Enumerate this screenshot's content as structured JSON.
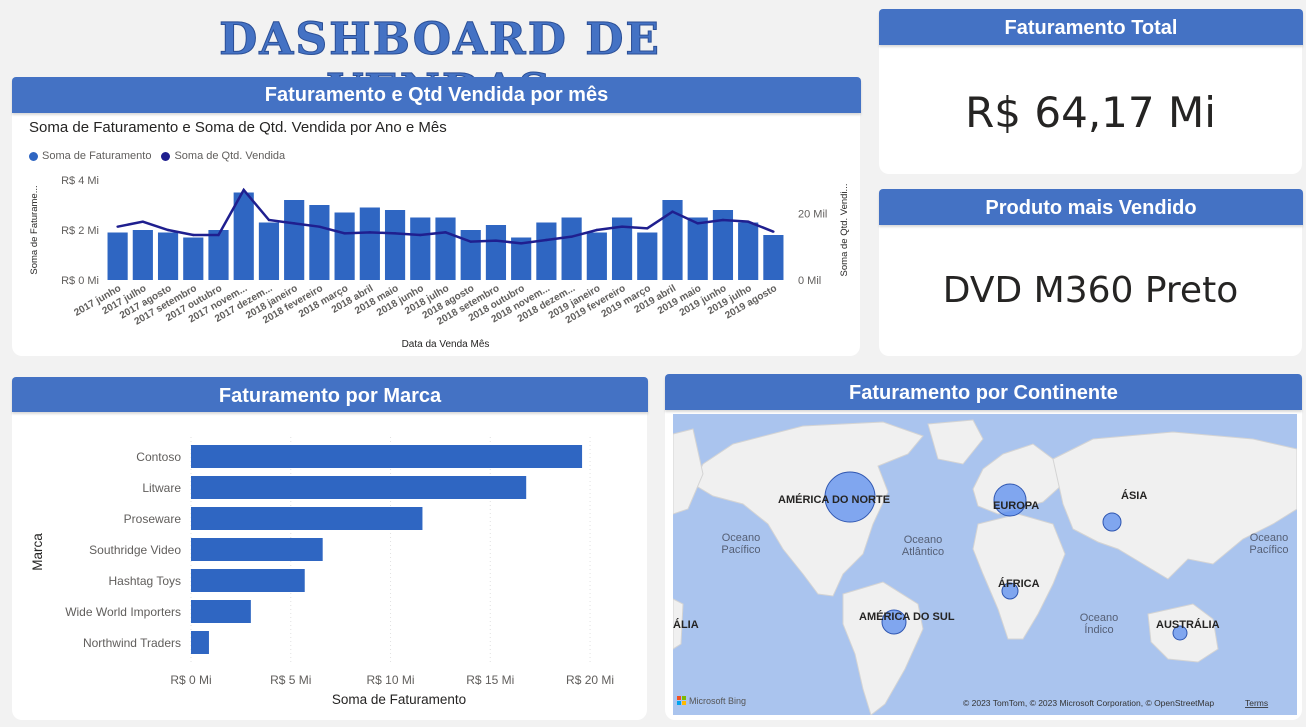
{
  "dashboard_title": "DASHBOARD DE VENDAS",
  "colors": {
    "accent": "#4472c4",
    "bar": "#2f66c2",
    "line": "#1f1f8f",
    "map_bubble": "#5b8def"
  },
  "kpi_total": {
    "header": "Faturamento Total",
    "value": "R$ 64,17 Mi"
  },
  "kpi_product": {
    "header": "Produto mais Vendido",
    "value": "DVD M360 Preto"
  },
  "combo": {
    "header": "Faturamento e Qtd Vendida por mês",
    "subtitle": "Soma de Faturamento e Soma de Qtd. Vendida por Ano e Mês",
    "legend": [
      "Soma de Faturamento",
      "Soma de Qtd. Vendida"
    ],
    "y_left_label": "Soma de Faturame...",
    "y_right_label": "Soma de Qtd. Vendi...",
    "x_label": "Data da Venda Mês",
    "y_left_ticks": [
      "R$ 0 Mi",
      "R$ 2 Mi",
      "R$ 4 Mi"
    ],
    "y_right_ticks": [
      "0 Mil",
      "20 Mil"
    ]
  },
  "brand": {
    "header": "Faturamento por Marca",
    "y_label": "Marca",
    "x_label": "Soma de Faturamento",
    "x_ticks": [
      "R$ 0 Mi",
      "R$ 5 Mi",
      "R$ 10 Mi",
      "R$ 15 Mi",
      "R$ 20 Mi"
    ]
  },
  "map": {
    "header": "Faturamento por Continente",
    "labels": [
      "AMÉRICA DO NORTE",
      "EUROPA",
      "ÁSIA",
      "ÁFRICA",
      "AMÉRICA DO SUL",
      "AUSTRÁLIA",
      "ÁLIA"
    ],
    "oceans": [
      "Oceano Pacífico",
      "Oceano Atlântico",
      "Oceano Índico",
      "Oceano Pacífico"
    ],
    "bing": "Microsoft Bing",
    "copyright": "© 2023 TomTom, © 2023 Microsoft Corporation, © OpenStreetMap",
    "terms": "Terms"
  },
  "chart_data": [
    {
      "type": "bar",
      "title": "Soma de Faturamento e Soma de Qtd. Vendida por Ano e Mês",
      "xlabel": "Data da Venda Mês",
      "ylabel": "Soma de Faturame...",
      "ylim": [
        0,
        4
      ],
      "y2label": "Soma de Qtd. Vendi...",
      "y2lim": [
        0,
        30
      ],
      "legend": "top-left",
      "categories": [
        "2017 junho",
        "2017 julho",
        "2017 agosto",
        "2017 setembro",
        "2017 outubro",
        "2017 novem...",
        "2017 dezem...",
        "2018 janeiro",
        "2018 fevereiro",
        "2018 março",
        "2018 abril",
        "2018 maio",
        "2018 junho",
        "2018 julho",
        "2018 agosto",
        "2018 setembro",
        "2018 outubro",
        "2018 novem...",
        "2018 dezem...",
        "2019 janeiro",
        "2019 fevereiro",
        "2019 março",
        "2019 abril",
        "2019 maio",
        "2019 junho",
        "2019 julho",
        "2019 agosto"
      ],
      "series": [
        {
          "name": "Soma de Faturamento",
          "kind": "bar",
          "axis": "left",
          "values": [
            1.9,
            2.0,
            1.9,
            1.7,
            2.0,
            3.5,
            2.3,
            3.2,
            3.0,
            2.7,
            2.9,
            2.8,
            2.5,
            2.5,
            2.0,
            2.2,
            1.7,
            2.3,
            2.5,
            1.9,
            2.5,
            1.9,
            3.2,
            2.5,
            2.8,
            2.3,
            1.8
          ]
        },
        {
          "name": "Soma de Qtd. Vendida",
          "kind": "line",
          "axis": "right",
          "values": [
            16,
            17.5,
            15,
            13.5,
            13.5,
            27,
            18,
            17,
            16,
            14,
            14.3,
            14,
            13.5,
            14.3,
            11.5,
            11.8,
            11,
            12,
            13,
            15,
            16,
            15.5,
            20.5,
            17,
            18,
            17.5,
            14.5
          ]
        }
      ]
    },
    {
      "type": "bar",
      "orientation": "horizontal",
      "title": "",
      "xlabel": "Soma de Faturamento",
      "ylabel": "Marca",
      "xlim": [
        0,
        21
      ],
      "categories": [
        "Contoso",
        "Litware",
        "Proseware",
        "Southridge Video",
        "Hashtag Toys",
        "Wide World Importers",
        "Northwind Traders"
      ],
      "values": [
        19.6,
        16.8,
        11.6,
        6.6,
        5.7,
        3.0,
        0.9
      ]
    }
  ]
}
